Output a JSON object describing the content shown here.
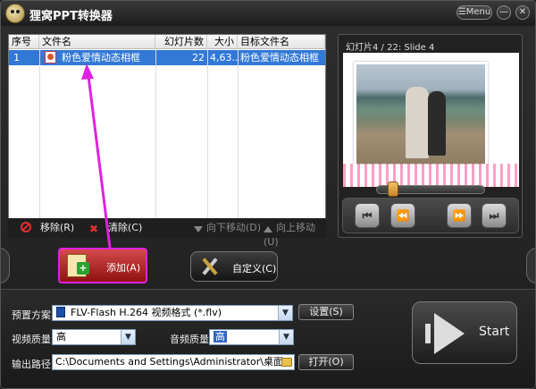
{
  "window": {
    "title": "狸窝PPT转换器",
    "menu_label": "Menu",
    "minimize_glyph": "—",
    "close_glyph": "✕"
  },
  "file_list": {
    "columns": [
      "序号",
      "文件名",
      "幻灯片数",
      "大小",
      "目标文件名"
    ],
    "rows": [
      {
        "index": "1",
        "name": "粉色爱情动态相框",
        "slides": "22",
        "size": "4,63...",
        "target": "粉色爱情动态相框"
      }
    ]
  },
  "list_toolbar": {
    "remove": "移除(R)",
    "clear": "清除(C)",
    "move_down": "向下移动(D)",
    "move_up": "向上移动(U)"
  },
  "preview": {
    "label": "幻灯片4 / 22: Slide 4",
    "progress_fraction": 0.12
  },
  "player": {
    "stop_glyph": "⏮",
    "rewind_glyph": "⏪",
    "forward_glyph": "⏩",
    "end_glyph": "⏭"
  },
  "actions": {
    "add": "添加(A)",
    "custom": "自定义(C)"
  },
  "settings": {
    "preset_label": "预置方案:",
    "preset_value": "FLV-Flash H.264 视频格式 (*.flv)",
    "settings_button": "设置(S)",
    "video_quality_label": "视频质量:",
    "video_quality_value": "高",
    "audio_quality_label": "音频质量:",
    "audio_quality_value": "高",
    "output_path_label": "输出路径:",
    "output_path_value": "C:\\Documents and Settings\\Administrator\\桌面",
    "open_button": "打开(O)",
    "start_button": "Start"
  },
  "colors": {
    "selection": "#3278d6",
    "annotation": "#e020e0",
    "add_button": "#b52a2a"
  }
}
